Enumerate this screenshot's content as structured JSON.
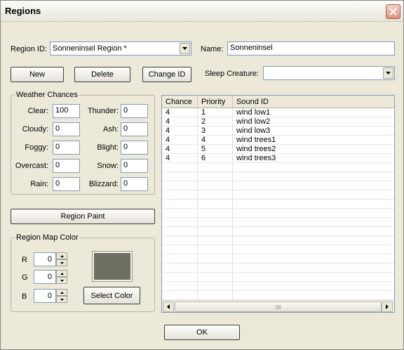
{
  "window": {
    "title": "Regions"
  },
  "region_id": {
    "label": "Region ID:",
    "value": "Sonneninsel Region *"
  },
  "name": {
    "label": "Name:",
    "value": "Sonneninsel"
  },
  "buttons": {
    "new": "New",
    "delete": "Delete",
    "change_id": "Change ID",
    "region_paint": "Region Paint",
    "select_color": "Select Color",
    "ok": "OK"
  },
  "sleep_creature": {
    "label": "Sleep Creature:",
    "value": ""
  },
  "weather": {
    "title": "Weather Chances",
    "left": [
      {
        "label": "Clear:",
        "value": "100"
      },
      {
        "label": "Cloudy:",
        "value": "0"
      },
      {
        "label": "Foggy:",
        "value": "0"
      },
      {
        "label": "Overcast:",
        "value": "0"
      },
      {
        "label": "Rain:",
        "value": "0"
      }
    ],
    "right": [
      {
        "label": "Thunder:",
        "value": "0"
      },
      {
        "label": "Ash:",
        "value": "0"
      },
      {
        "label": "Blight:",
        "value": "0"
      },
      {
        "label": "Snow:",
        "value": "0"
      },
      {
        "label": "Blizzard:",
        "value": "0"
      }
    ]
  },
  "map_color": {
    "title": "Region Map Color",
    "channels": [
      {
        "label": "R",
        "value": "0"
      },
      {
        "label": "G",
        "value": "0"
      },
      {
        "label": "B",
        "value": "0"
      }
    ],
    "swatch_color": "#6f6e63"
  },
  "sounds": {
    "columns": [
      "Chance",
      "Priority",
      "Sound ID"
    ],
    "rows": [
      [
        "4",
        "1",
        "wind low1"
      ],
      [
        "4",
        "2",
        "wind low2"
      ],
      [
        "4",
        "3",
        "wind low3"
      ],
      [
        "4",
        "4",
        "wind trees1"
      ],
      [
        "4",
        "5",
        "wind trees2"
      ],
      [
        "4",
        "6",
        "wind trees3"
      ]
    ]
  },
  "icons": {
    "close": "close-icon",
    "dropdown": "chevron-down-icon",
    "scroll_left": "arrow-left-icon",
    "scroll_right": "arrow-right-icon",
    "spin_up": "arrow-up-icon",
    "spin_down": "arrow-down-icon"
  }
}
